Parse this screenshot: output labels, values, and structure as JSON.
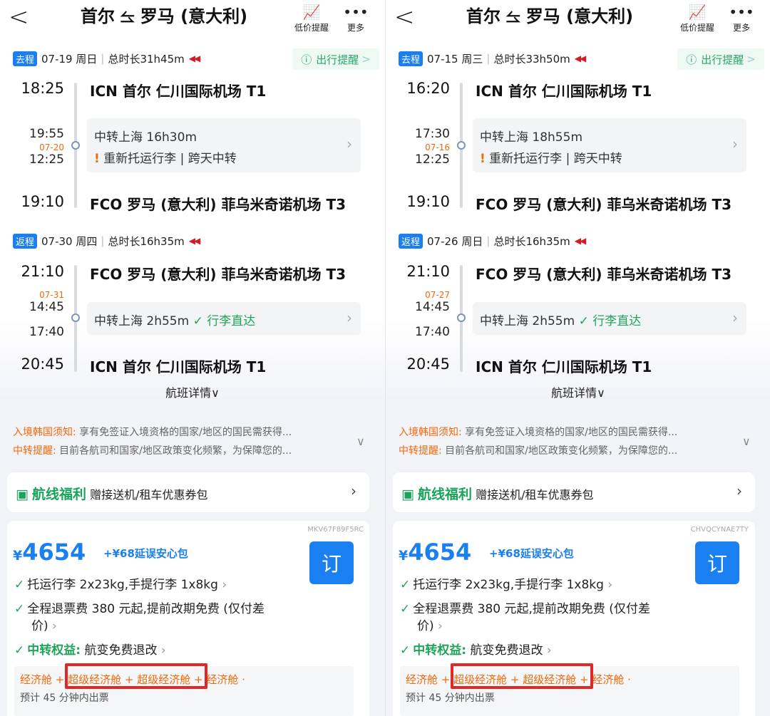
{
  "panels": [
    {
      "title": "首尔 ⥦ 罗马 (意大利)",
      "low_price_label": "低价提醒",
      "more_label": "更多",
      "outbound": {
        "tag": "去程",
        "date": "07-19 周日",
        "duration": "总时长31h45m",
        "dep_time": "18:25",
        "dep_airport": "ICN 首尔 仁川国际机场 T1",
        "arr1_time": "19:55",
        "next_date": "07-20",
        "dep2_time": "12:25",
        "transfer": "中转上海 16h30m",
        "transfer_note": "重新托运行李 | 跨天中转",
        "arr_time": "19:10",
        "arr_airport": "FCO 罗马 (意大利) 菲乌米奇诺机场 T3"
      },
      "travel_reminder": "出行提醒",
      "return": {
        "tag": "返程",
        "date": "07-30 周四",
        "duration": "总时长16h35m",
        "dep_time": "21:10",
        "dep_airport": "FCO 罗马 (意大利) 菲乌米奇诺机场 T3",
        "next_date": "07-31",
        "arr1_time": "14:45",
        "dep2_time": "17:40",
        "transfer": "中转上海 2h55m",
        "transfer_note": "行李直达",
        "arr_time": "20:45",
        "arr_airport": "ICN 首尔 仁川国际机场 T1"
      },
      "details": "航班详情",
      "notice1_label": "入境韩国须知:",
      "notice1_text": "享有免签证入境资格的国家/地区的国民需获得...",
      "notice2_label": "中转提醒:",
      "notice2_text": "目前各航司和国家/地区政策变化频繁，为保障您的...",
      "welfare_title": "航线福利",
      "welfare_text": "赠接送机/租车优惠券包",
      "code": "MKV67F89F5RC",
      "currency": "¥",
      "price": "4654",
      "addon": "+¥68延误安心包",
      "book": "订",
      "feat1": "托运行李 2x23kg,手提行李 1x8kg",
      "feat2": "全程退票费 380 元起,提前改期免费 (仅付差",
      "feat2b": "价)",
      "feat3_label": "中转权益:",
      "feat3_text": "航变免费退改",
      "cabin": "经济舱 + 超级经济舱 + 超级经济舱 + 经济舱 ·",
      "ticketing": "预计 45 分钟内出票"
    },
    {
      "title": "首尔 ⥦ 罗马 (意大利)",
      "low_price_label": "低价提醒",
      "more_label": "更多",
      "outbound": {
        "tag": "去程",
        "date": "07-15 周三",
        "duration": "总时长33h50m",
        "dep_time": "16:20",
        "dep_airport": "ICN 首尔 仁川国际机场 T1",
        "arr1_time": "17:30",
        "next_date": "07-16",
        "dep2_time": "12:25",
        "transfer": "中转上海 18h55m",
        "transfer_note": "重新托运行李 | 跨天中转",
        "arr_time": "19:10",
        "arr_airport": "FCO 罗马 (意大利) 菲乌米奇诺机场 T3"
      },
      "travel_reminder": "出行提醒",
      "return": {
        "tag": "返程",
        "date": "07-26 周日",
        "duration": "总时长16h35m",
        "dep_time": "21:10",
        "dep_airport": "FCO 罗马 (意大利) 菲乌米奇诺机场 T3",
        "next_date": "07-27",
        "arr1_time": "14:45",
        "dep2_time": "17:40",
        "transfer": "中转上海 2h55m",
        "transfer_note": "行李直达",
        "arr_time": "20:45",
        "arr_airport": "ICN 首尔 仁川国际机场 T1"
      },
      "details": "航班详情",
      "notice1_label": "入境韩国须知:",
      "notice1_text": "享有免签证入境资格的国家/地区的国民需获得...",
      "notice2_label": "中转提醒:",
      "notice2_text": "目前各航司和国家/地区政策变化频繁，为保障您的...",
      "welfare_title": "航线福利",
      "welfare_text": "赠接送机/租车优惠券包",
      "code": "CHVQCYNAE7TY",
      "currency": "¥",
      "price": "4654",
      "addon": "+¥68延误安心包",
      "book": "订",
      "feat1": "托运行李 2x23kg,手提行李 1x8kg",
      "feat2": "全程退票费 380 元起,提前改期免费 (仅付差",
      "feat2b": "价)",
      "feat3_label": "中转权益:",
      "feat3_text": "航变免费退改",
      "cabin": "经济舱 + 超级经济舱 + 超级经济舱 + 经济舱 ·",
      "ticketing": "预计 45 分钟内出票"
    }
  ],
  "colors": {
    "accent": "#1a7ff0",
    "orange": "#f2690b",
    "green": "#22a35a",
    "highlight": "#e02828"
  }
}
